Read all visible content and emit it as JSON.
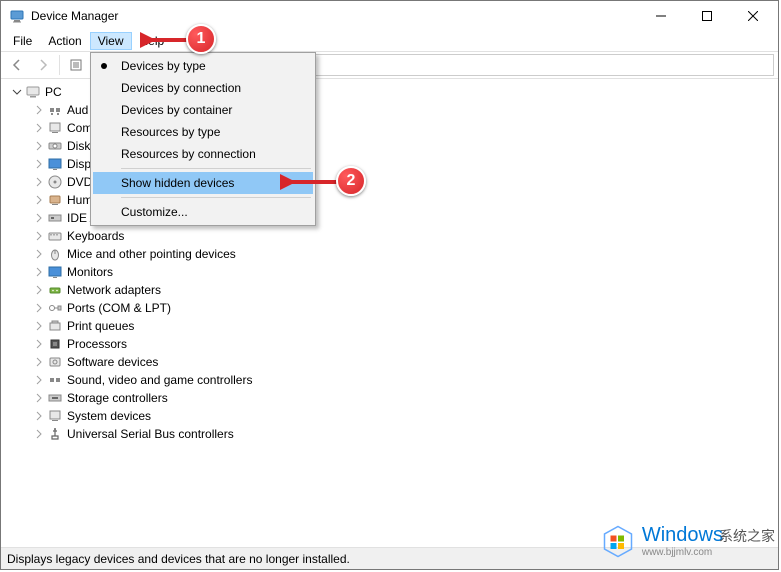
{
  "window": {
    "title": "Device Manager"
  },
  "menubar": {
    "file": "File",
    "action": "Action",
    "view": "View",
    "help": "Help"
  },
  "dropdown": {
    "devices_by_type": "Devices by type",
    "devices_by_connection": "Devices by connection",
    "devices_by_container": "Devices by container",
    "resources_by_type": "Resources by type",
    "resources_by_connection": "Resources by connection",
    "show_hidden_devices": "Show hidden devices",
    "customize": "Customize..."
  },
  "tree": {
    "root": "PC",
    "items": [
      {
        "label": "Audio inputs and outputs",
        "visible_label": "Aud"
      },
      {
        "label": "Computer",
        "visible_label": "Com"
      },
      {
        "label": "Disk drives",
        "visible_label": "Disk"
      },
      {
        "label": "Display adapters",
        "visible_label": "Disp"
      },
      {
        "label": "DVD/CD-ROM drives",
        "visible_label": "DVD"
      },
      {
        "label": "Human Interface Devices",
        "visible_label": "Hum"
      },
      {
        "label": "IDE ATA/ATAPI controllers",
        "visible_label": "IDE A"
      },
      {
        "label": "Keyboards",
        "visible_label": "Keyboards"
      },
      {
        "label": "Mice and other pointing devices",
        "visible_label": "Mice and other pointing devices"
      },
      {
        "label": "Monitors",
        "visible_label": "Monitors"
      },
      {
        "label": "Network adapters",
        "visible_label": "Network adapters"
      },
      {
        "label": "Ports (COM & LPT)",
        "visible_label": "Ports (COM & LPT)"
      },
      {
        "label": "Print queues",
        "visible_label": "Print queues"
      },
      {
        "label": "Processors",
        "visible_label": "Processors"
      },
      {
        "label": "Software devices",
        "visible_label": "Software devices"
      },
      {
        "label": "Sound, video and game controllers",
        "visible_label": "Sound, video and game controllers"
      },
      {
        "label": "Storage controllers",
        "visible_label": "Storage controllers"
      },
      {
        "label": "System devices",
        "visible_label": "System devices"
      },
      {
        "label": "Universal Serial Bus controllers",
        "visible_label": "Universal Serial Bus controllers"
      }
    ]
  },
  "statusbar": {
    "text": "Displays legacy devices and devices that are no longer installed."
  },
  "callouts": {
    "one": "1",
    "two": "2"
  },
  "watermark": {
    "brand": "Windows",
    "tagline": "系统之家",
    "url": "www.bjjmlv.com"
  },
  "icons": {
    "back": "back-icon",
    "forward": "forward-icon",
    "properties": "properties-icon",
    "help": "help-icon"
  }
}
